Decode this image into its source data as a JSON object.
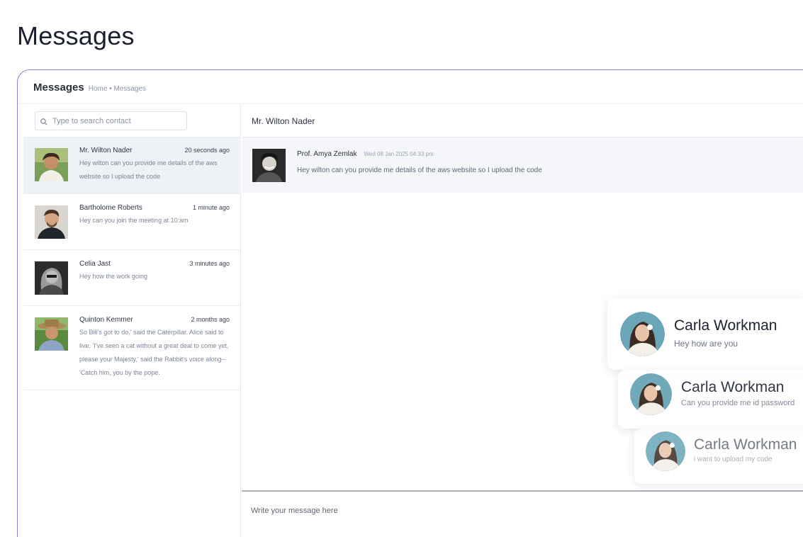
{
  "page": {
    "title": "Messages"
  },
  "panel": {
    "title": "Messages",
    "breadcrumb": "Home • Messages"
  },
  "search": {
    "placeholder": "Type to search contact"
  },
  "contacts": [
    {
      "name": "Mr. Wilton Nader",
      "time": "20 seconds ago",
      "message": "Hey wilton can you provide me details of the aws website so I upload the code",
      "active": true
    },
    {
      "name": "Bartholome Roberts",
      "time": "1 minute ago",
      "message": "Hey can you join the meeting at 10:am"
    },
    {
      "name": "Celia Jast",
      "time": "3 minutes ago",
      "message": "Hey how the work going"
    },
    {
      "name": "Quinton Kemmer",
      "time": "2 months ago",
      "message": "So Bill's got to do,' said the Caterpillar. Alice said to live. 'I've seen a cat without a great deal to come yet, please your Majesty,' said the Rabbit's voice along--'Catch him, you by the pope."
    }
  ],
  "chat": {
    "header": "Mr. Wilton Nader",
    "messages": [
      {
        "sender": "Prof. Amya Zemlak",
        "time": "Wed 08 Jan 2025 04:33 pm",
        "text": "Hey wilton can you provide me details of the aws website so I upload the code"
      }
    ],
    "composer_placeholder": "Write your message here"
  },
  "notifications": [
    {
      "name": "Carla Workman",
      "message": "Hey how are you"
    },
    {
      "name": "Carla Workman",
      "message": "Can you provide me id password"
    },
    {
      "name": "Carla Workman",
      "message": "i want to upload my code"
    }
  ]
}
